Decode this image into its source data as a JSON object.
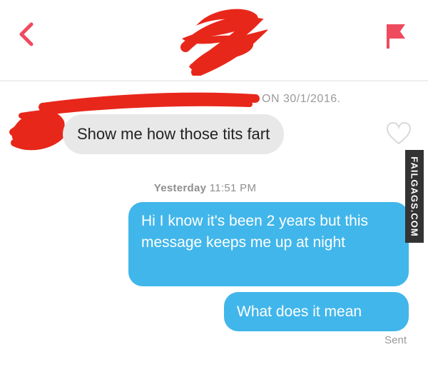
{
  "header": {
    "back_icon": "chevron-left-icon",
    "report_icon": "flag-icon",
    "accent_color": "#f04a5e"
  },
  "conversation": {
    "match_info_visible": "N ON 30/1/2016.",
    "incoming_message": "Show me how those tits fart",
    "like_icon": "heart-outline-icon",
    "timestamp_day": "Yesterday",
    "timestamp_time": "11:51 PM",
    "outgoing_messages": [
      "Hi I know it's been 2 years but this message keeps me up at night",
      "What does it mean"
    ],
    "status": "Sent",
    "outgoing_color": "#41b6ea",
    "incoming_color": "#e8e8e8"
  },
  "watermark": {
    "text": "FAILGAGS.COM"
  }
}
